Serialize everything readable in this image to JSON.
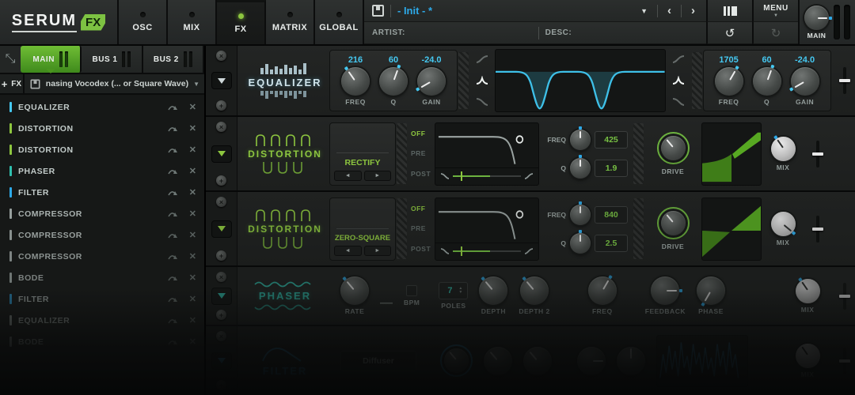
{
  "palette": {
    "green": "#8dc63f",
    "cyan": "#45c8f1",
    "teal": "#2fbfae",
    "blue": "#2da9e8"
  },
  "icons": {
    "dropdown": "▼",
    "prev": "‹",
    "next": "›",
    "undo": "↺",
    "redo": "↻",
    "menu_caret": "▼",
    "add": "+",
    "close": "✕",
    "collapse": "⤡",
    "step_up": "▲",
    "step_down": "▼",
    "arrow_left": "◄",
    "arrow_right": "►"
  },
  "header": {
    "logo_text": "SERUM",
    "logo_badge": "FX",
    "tabs": [
      {
        "label": "OSC"
      },
      {
        "label": "MIX"
      },
      {
        "label": "FX"
      },
      {
        "label": "MATRIX"
      },
      {
        "label": "GLOBAL"
      }
    ],
    "preset_name": "- Init - *",
    "artist_label": "ARTIST:",
    "desc_label": "DESC:",
    "menu_label": "MENU",
    "main_knob_label": "MAIN"
  },
  "sidebar": {
    "bus_tabs": [
      {
        "label": "MAIN"
      },
      {
        "label": "BUS 1"
      },
      {
        "label": "BUS 2"
      }
    ],
    "add_fx_label": "FX",
    "chain_preset": "nasing Vocodex (... or Square Wave)",
    "fx_list": [
      {
        "label": "EQUALIZER"
      },
      {
        "label": "DISTORTION"
      },
      {
        "label": "DISTORTION"
      },
      {
        "label": "PHASER"
      },
      {
        "label": "FILTER"
      },
      {
        "label": "COMPRESSOR"
      },
      {
        "label": "COMPRESSOR"
      },
      {
        "label": "COMPRESSOR"
      },
      {
        "label": "BODE"
      },
      {
        "label": "FILTER"
      },
      {
        "label": "EQUALIZER"
      },
      {
        "label": "BODE"
      }
    ]
  },
  "rack": {
    "equalizer": {
      "title": "EQUALIZER",
      "left": {
        "freq_value": "216",
        "freq_label": "FREQ",
        "q_value": "60",
        "q_label": "Q",
        "gain_value": "-24.0",
        "gain_label": "GAIN"
      },
      "right": {
        "freq_value": "1705",
        "freq_label": "FREQ",
        "q_value": "60",
        "q_label": "Q",
        "gain_value": "-24.0",
        "gain_label": "GAIN"
      }
    },
    "distortion1": {
      "title": "DISTORTION",
      "mode": "RECTIFY",
      "off_label": "OFF",
      "pre_label": "PRE",
      "post_label": "POST",
      "freq_label": "FREQ",
      "freq_value": "425",
      "q_label": "Q",
      "q_value": "1.9",
      "drive_label": "DRIVE",
      "mix_label": "MIX"
    },
    "distortion2": {
      "title": "DISTORTION",
      "mode": "ZERO-SQUARE",
      "off_label": "OFF",
      "pre_label": "PRE",
      "post_label": "POST",
      "freq_label": "FREQ",
      "freq_value": "840",
      "q_label": "Q",
      "q_value": "2.5",
      "drive_label": "DRIVE",
      "mix_label": "MIX"
    },
    "phaser": {
      "title": "PHASER",
      "rate_label": "RATE",
      "bpm_label": "BPM",
      "poles_label": "POLES",
      "poles_value": "7",
      "depth_label": "DEPTH",
      "depth2_label": "DEPTH 2",
      "freq_label": "FREQ",
      "feedback_label": "FEEDBACK",
      "phase_label": "PHASE",
      "mix_label": "MIX"
    },
    "filter": {
      "title": "FILTER",
      "mode": "Diffuser",
      "mix_label": "MIX"
    }
  }
}
